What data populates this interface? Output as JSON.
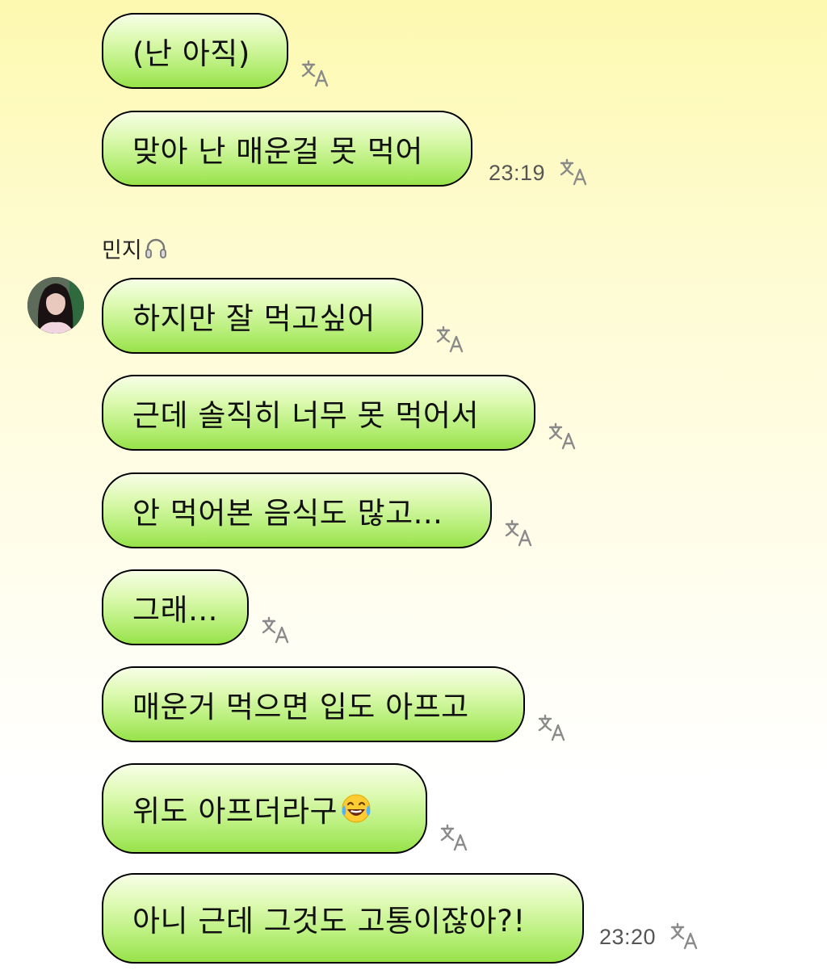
{
  "contact": {
    "name": "민지",
    "name_icon": "headphone-icon",
    "avatar_icon": "avatar"
  },
  "messages": [
    {
      "text": "(난 아직)",
      "time": ""
    },
    {
      "text": "맞아 난 매운걸 못 먹어",
      "time": "23:19"
    },
    {
      "text": "하지만 잘 먹고싶어",
      "time": ""
    },
    {
      "text": "근데 솔직히 너무 못 먹어서",
      "time": ""
    },
    {
      "text": "안 먹어본 음식도 많고...",
      "time": ""
    },
    {
      "text": "그래...",
      "time": ""
    },
    {
      "text": "매운거 먹으면 입도 아프고",
      "time": ""
    },
    {
      "text": "위도 아프더라구",
      "time": "",
      "emoji": "face-with-tears-of-joy-icon"
    },
    {
      "text": "아니 근데 그것도 고통이잖아?!",
      "time": "23:20"
    }
  ],
  "colors": {
    "bubble_top": "#f7ffe6",
    "bubble_bottom": "#98e24a",
    "border": "#000000",
    "background_top": "#fdf9b0",
    "time_text": "#555555"
  }
}
